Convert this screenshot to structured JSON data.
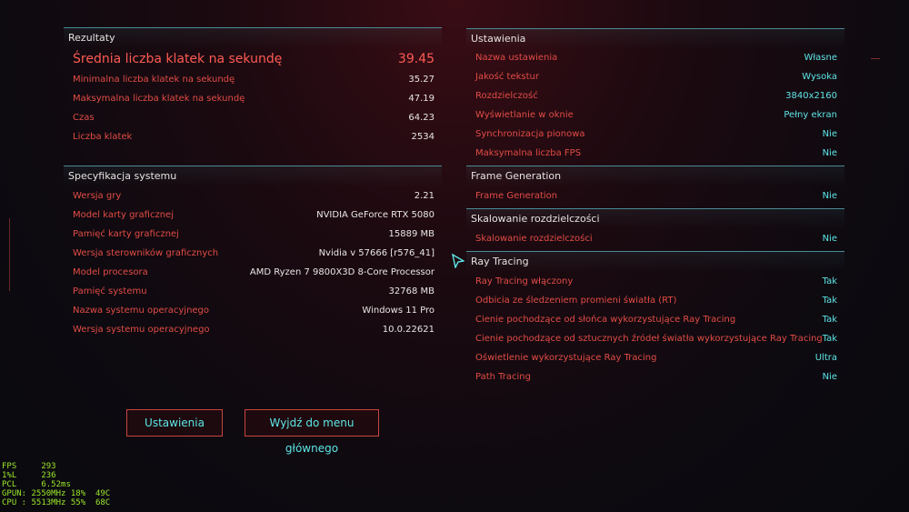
{
  "results": {
    "title": "Rezultaty",
    "avg_fps_label": "Średnia liczba klatek na sekundę",
    "avg_fps_value": "39.45",
    "rows": [
      {
        "label": "Minimalna liczba klatek na sekundę",
        "value": "35.27"
      },
      {
        "label": "Maksymalna liczba klatek na sekundę",
        "value": "47.19"
      },
      {
        "label": "Czas",
        "value": "64.23"
      },
      {
        "label": "Liczba klatek",
        "value": "2534"
      }
    ]
  },
  "system": {
    "title": "Specyfikacja systemu",
    "rows": [
      {
        "label": "Wersja gry",
        "value": "2.21"
      },
      {
        "label": "Model karty graficznej",
        "value": "NVIDIA GeForce RTX 5080"
      },
      {
        "label": "Pamięć karty graficznej",
        "value": "15889 MB"
      },
      {
        "label": "Wersja sterowników graficznych",
        "value": "Nvidia v 57666 [r576_41]"
      },
      {
        "label": "Model procesora",
        "value": "AMD Ryzen 7 9800X3D 8-Core Processor"
      },
      {
        "label": "Pamięć systemu",
        "value": "32768 MB"
      },
      {
        "label": "Nazwa systemu operacyjnego",
        "value": "Windows 11 Pro"
      },
      {
        "label": "Wersja systemu operacyjnego",
        "value": "10.0.22621"
      }
    ]
  },
  "settings": {
    "title": "Ustawienia",
    "rows": [
      {
        "label": "Nazwa ustawienia",
        "value": "Własne"
      },
      {
        "label": "Jakość tekstur",
        "value": "Wysoka"
      },
      {
        "label": "Rozdzielczość",
        "value": "3840x2160"
      },
      {
        "label": "Wyświetlanie w oknie",
        "value": "Pełny ekran"
      },
      {
        "label": "Synchronizacja pionowa",
        "value": "Nie"
      },
      {
        "label": "Maksymalna liczba FPS",
        "value": "Nie"
      }
    ]
  },
  "frame_gen": {
    "title": "Frame Generation",
    "rows": [
      {
        "label": "Frame Generation",
        "value": "Nie"
      }
    ]
  },
  "scaling": {
    "title": "Skalowanie rozdzielczości",
    "rows": [
      {
        "label": "Skalowanie rozdzielczości",
        "value": "Nie"
      }
    ]
  },
  "ray_tracing": {
    "title": "Ray Tracing",
    "rows": [
      {
        "label": "Ray Tracing włączony",
        "value": "Tak"
      },
      {
        "label": "Odbicia ze śledzeniem promieni światła (RT)",
        "value": "Tak"
      },
      {
        "label": "Cienie pochodzące od słońca wykorzystujące Ray Tracing",
        "value": "Tak"
      },
      {
        "label": "Cienie pochodzące od sztucznych źródeł światła wykorzystujące Ray Tracing",
        "value": "Tak"
      },
      {
        "label": "Oświetlenie wykorzystujące Ray Tracing",
        "value": "Ultra"
      },
      {
        "label": "Path Tracing",
        "value": "Nie"
      }
    ]
  },
  "buttons": {
    "settings": "Ustawienia",
    "exit": "Wyjdź do menu głównego"
  },
  "hud": {
    "line1": "FPS     293",
    "line2": "1%L     236",
    "line3": "PCL     6.52ms",
    "line4": "GPUN: 2550MHz 18%  49C",
    "line5": "CPU : 5513MHz 55%  68C"
  },
  "colors": {
    "label_red": "#e24c45",
    "value_cyan": "#5ee6e8",
    "border_teal": "#4a8a94",
    "hud_green": "#9ce82a"
  }
}
